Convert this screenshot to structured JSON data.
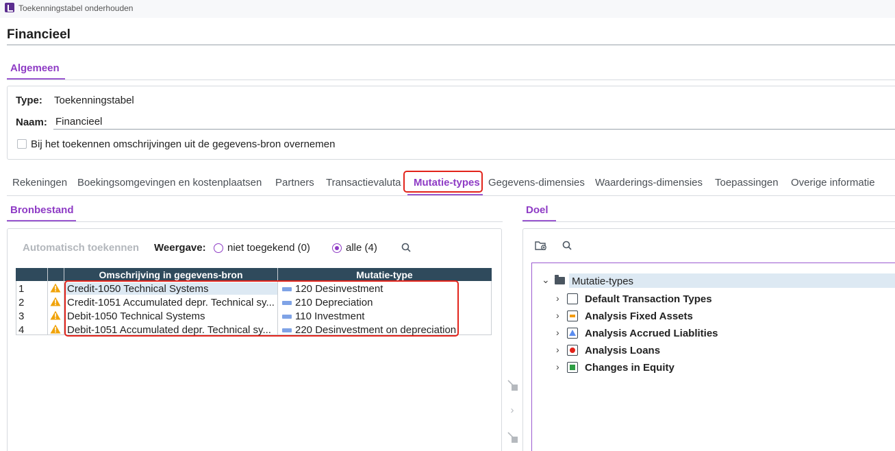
{
  "window": {
    "title": "Toekenningstabel onderhouden"
  },
  "page": {
    "title": "Financieel"
  },
  "general": {
    "tab_label": "Algemeen",
    "type_label": "Type:",
    "type_value": "Toekenningstabel",
    "naam_label": "Naam:",
    "naam_value": "Financieel",
    "checkbox_label": "Bij het toekennen omschrijvingen uit de gegevens-bron overnemen",
    "checkbox_checked": false
  },
  "main_tabs": [
    {
      "label": "Rekeningen"
    },
    {
      "label": "Boekingsomgevingen en kostenplaatsen"
    },
    {
      "label": "Partners"
    },
    {
      "label": "Transactievaluta"
    },
    {
      "label": "Mutatie-types",
      "active": true
    },
    {
      "label": "Gegevens-dimensies"
    },
    {
      "label": "Waarderings-dimensies"
    },
    {
      "label": "Toepassingen"
    },
    {
      "label": "Overige informatie"
    }
  ],
  "source": {
    "tab_label": "Bronbestand",
    "auto_assign_label": "Automatisch toekennen",
    "weergave_label": "Weergave:",
    "radio_options": [
      {
        "label": "niet toegekend (0)",
        "selected": false
      },
      {
        "label": "alle (4)",
        "selected": true
      }
    ],
    "table": {
      "columns": [
        "Omschrijving in gegevens-bron",
        "Mutatie-type"
      ],
      "rows": [
        {
          "num": "1",
          "omschrijving": "Credit-1050 Technical Systems",
          "mutatie": "120 Desinvestment"
        },
        {
          "num": "2",
          "omschrijving": "Credit-1051 Accumulated depr. Technical sy...",
          "mutatie": "210 Depreciation"
        },
        {
          "num": "3",
          "omschrijving": "Debit-1050 Technical Systems",
          "mutatie": "110 Investment"
        },
        {
          "num": "4",
          "omschrijving": "Debit-1051 Accumulated depr. Technical sy...",
          "mutatie": "220 Desinvestment on depreciation"
        }
      ]
    }
  },
  "target": {
    "tab_label": "Doel",
    "tree": {
      "root": "Mutatie-types",
      "children": [
        {
          "label": "Default Transaction Types",
          "icon": "empty-box-icon"
        },
        {
          "label": "Analysis Fixed Assets",
          "icon": "orange-bar-icon",
          "color": "#f39c12"
        },
        {
          "label": "Analysis Accrued Liablities",
          "icon": "blue-triangle-icon",
          "color": "#5b8def"
        },
        {
          "label": "Analysis Loans",
          "icon": "red-dot-icon",
          "color": "#e2231a"
        },
        {
          "label": "Changes in Equity",
          "icon": "green-square-icon",
          "color": "#2e9e44"
        }
      ]
    }
  },
  "colors": {
    "accent": "#8e3bc5",
    "header": "#2f4a5c",
    "highlight": "#e2231a"
  }
}
